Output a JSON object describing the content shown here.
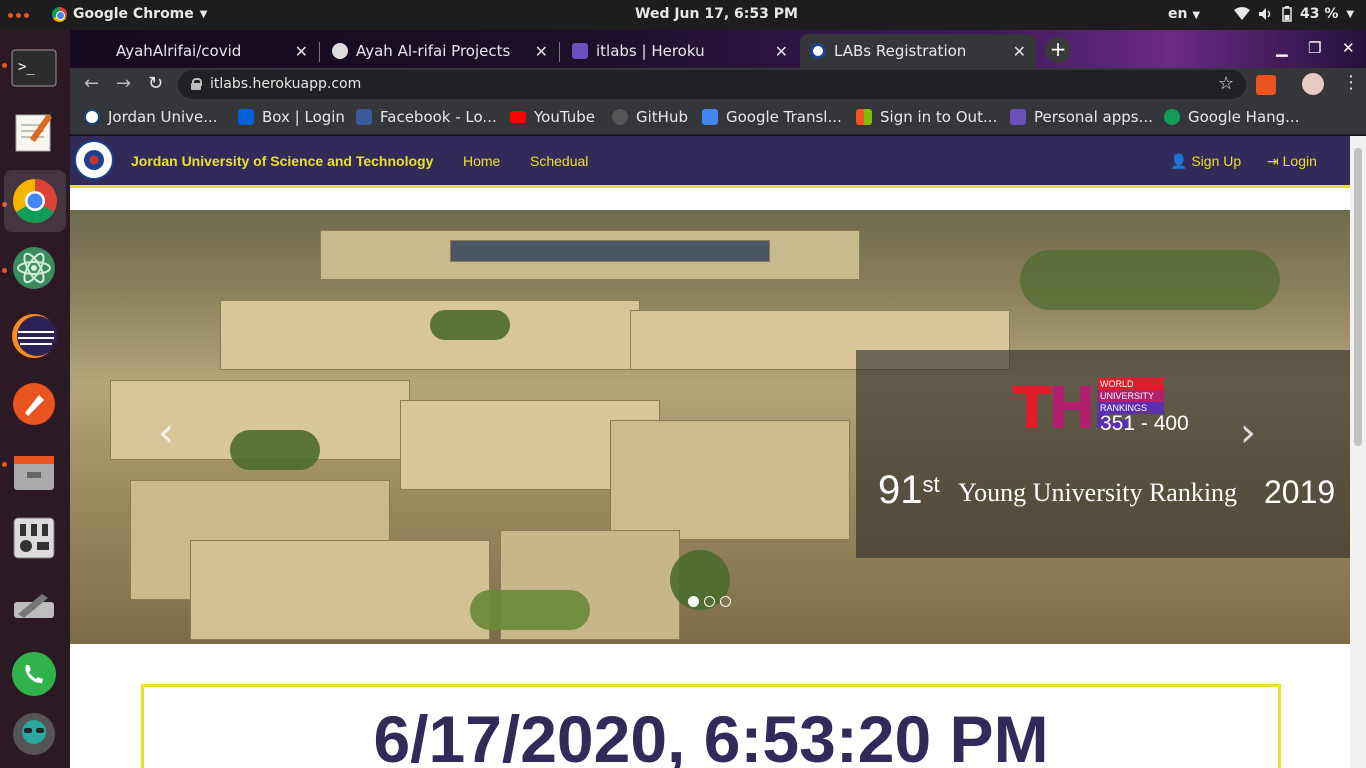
{
  "os": {
    "app_name": "Google Chrome",
    "clock": "Wed Jun 17,  6:53 PM",
    "lang": "en",
    "battery": "43 %"
  },
  "tabs": [
    {
      "title": "AyahAlrifai/covid"
    },
    {
      "title": "Ayah Al-rifai Projects"
    },
    {
      "title": "itlabs | Heroku"
    },
    {
      "title": "LABs Registration"
    }
  ],
  "url": "itlabs.herokuapp.com",
  "bookmarks": [
    {
      "label": "Jordan Unive..."
    },
    {
      "label": "Box | Login"
    },
    {
      "label": "Facebook - Lo..."
    },
    {
      "label": "YouTube"
    },
    {
      "label": "GitHub"
    },
    {
      "label": "Google Transl..."
    },
    {
      "label": "Sign in to Out..."
    },
    {
      "label": "Personal apps..."
    },
    {
      "label": "Google Hang..."
    }
  ],
  "navbar": {
    "brand": "Jordan University of Science and Technology",
    "home": "Home",
    "schedule": "Schedual",
    "signup": "Sign Up",
    "login": "Login"
  },
  "hero": {
    "the_logo": {
      "t": "T",
      "h": "H",
      "e": "E"
    },
    "wur_lines": [
      "WORLD",
      "UNIVERSITY",
      "RANKINGS"
    ],
    "range": "351 - 400",
    "rank_number": "91",
    "rank_suffix": "st",
    "rank_text": "Young University Ranking",
    "rank_year": "2019",
    "slides": 3,
    "active_slide": 1
  },
  "clock_display": "6/17/2020, 6:53:20 PM",
  "colors": {
    "nav_bg": "#322a59",
    "accent_yellow": "#e9e12a",
    "ubuntu_orange": "#e95420"
  }
}
